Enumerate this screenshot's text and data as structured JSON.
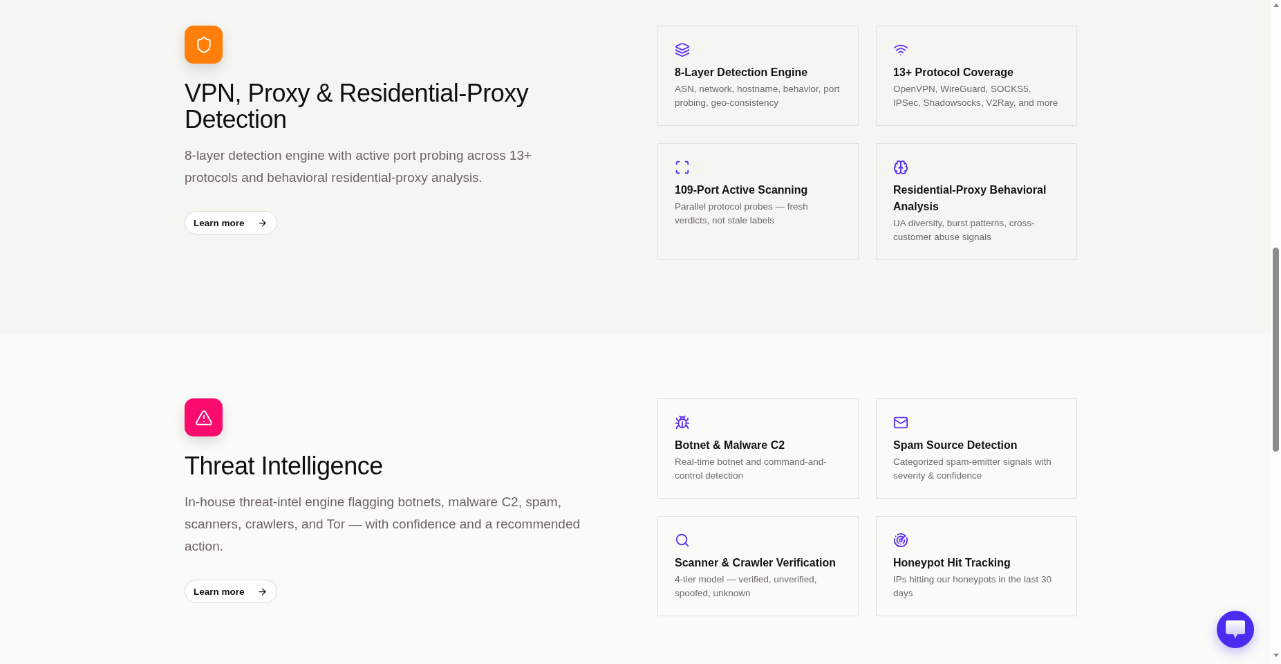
{
  "sections": [
    {
      "color": "#ff7f0a",
      "title": "VPN, Proxy & Residential-Proxy Detection",
      "description": "8-layer detection engine with active port probing across 13+ protocols and behavioral residential-proxy analysis.",
      "link": "Learn more",
      "features": [
        {
          "title": "8-Layer Detection Engine",
          "description": "ASN, network, hostname, behavior, port probing, geo-consistency"
        },
        {
          "title": "13+ Protocol Coverage",
          "description": "OpenVPN, WireGuard, SOCKS5, IPSec, Shadowsocks, V2Ray, and more"
        },
        {
          "title": "109-Port Active Scanning",
          "description": "Parallel protocol probes — fresh verdicts, not stale labels"
        },
        {
          "title": "Residential-Proxy Behavioral Analysis",
          "description": "UA diversity, burst patterns, cross-customer abuse signals"
        }
      ]
    },
    {
      "color": "#fb0b6e",
      "title": "Threat Intelligence",
      "description": "In-house threat-intel engine flagging botnets, malware C2, spam, scanners, crawlers, and Tor — with confidence and a recommended action.",
      "link": "Learn more",
      "features": [
        {
          "title": "Botnet & Malware C2",
          "description": "Real-time botnet and command-and-control detection"
        },
        {
          "title": "Spam Source Detection",
          "description": "Categorized spam-emitter signals with severity & confidence"
        },
        {
          "title": "Scanner & Crawler Verification",
          "description": "4-tier model — verified, unverified, spoofed, unknown"
        },
        {
          "title": "Honeypot Hit Tracking",
          "description": "IPs hitting our honeypots in the last 30 days"
        }
      ]
    }
  ]
}
